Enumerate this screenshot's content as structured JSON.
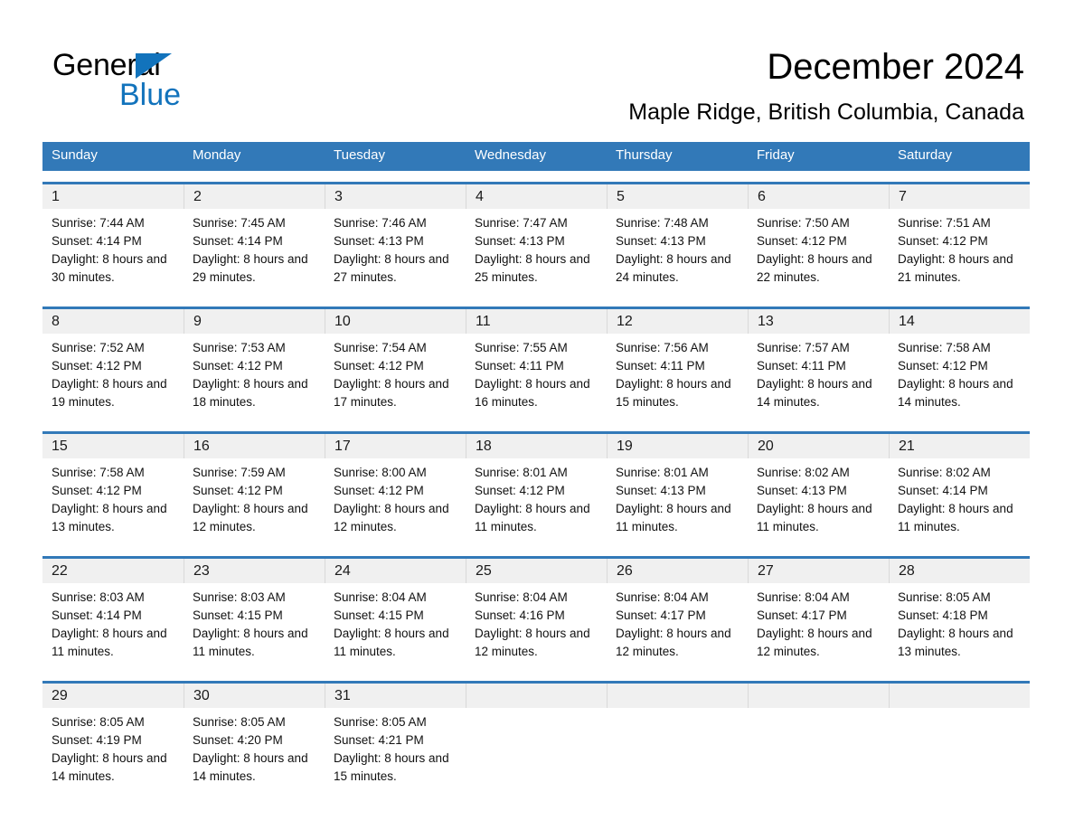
{
  "brand": {
    "name_part1": "General",
    "name_part2": "Blue",
    "accent_color": "#1273BC"
  },
  "header": {
    "title": "December 2024",
    "subtitle": "Maple Ridge, British Columbia, Canada"
  },
  "calendar": {
    "header_bg": "#3279B8",
    "header_text_color": "#FFFFFF",
    "daynum_bg": "#F0F0F0",
    "weekday_headers": [
      "Sunday",
      "Monday",
      "Tuesday",
      "Wednesday",
      "Thursday",
      "Friday",
      "Saturday"
    ],
    "weeks": [
      {
        "days": [
          {
            "num": "1",
            "sunrise": "Sunrise: 7:44 AM",
            "sunset": "Sunset: 4:14 PM",
            "daylight": "Daylight: 8 hours and 30 minutes."
          },
          {
            "num": "2",
            "sunrise": "Sunrise: 7:45 AM",
            "sunset": "Sunset: 4:14 PM",
            "daylight": "Daylight: 8 hours and 29 minutes."
          },
          {
            "num": "3",
            "sunrise": "Sunrise: 7:46 AM",
            "sunset": "Sunset: 4:13 PM",
            "daylight": "Daylight: 8 hours and 27 minutes."
          },
          {
            "num": "4",
            "sunrise": "Sunrise: 7:47 AM",
            "sunset": "Sunset: 4:13 PM",
            "daylight": "Daylight: 8 hours and 25 minutes."
          },
          {
            "num": "5",
            "sunrise": "Sunrise: 7:48 AM",
            "sunset": "Sunset: 4:13 PM",
            "daylight": "Daylight: 8 hours and 24 minutes."
          },
          {
            "num": "6",
            "sunrise": "Sunrise: 7:50 AM",
            "sunset": "Sunset: 4:12 PM",
            "daylight": "Daylight: 8 hours and 22 minutes."
          },
          {
            "num": "7",
            "sunrise": "Sunrise: 7:51 AM",
            "sunset": "Sunset: 4:12 PM",
            "daylight": "Daylight: 8 hours and 21 minutes."
          }
        ]
      },
      {
        "days": [
          {
            "num": "8",
            "sunrise": "Sunrise: 7:52 AM",
            "sunset": "Sunset: 4:12 PM",
            "daylight": "Daylight: 8 hours and 19 minutes."
          },
          {
            "num": "9",
            "sunrise": "Sunrise: 7:53 AM",
            "sunset": "Sunset: 4:12 PM",
            "daylight": "Daylight: 8 hours and 18 minutes."
          },
          {
            "num": "10",
            "sunrise": "Sunrise: 7:54 AM",
            "sunset": "Sunset: 4:12 PM",
            "daylight": "Daylight: 8 hours and 17 minutes."
          },
          {
            "num": "11",
            "sunrise": "Sunrise: 7:55 AM",
            "sunset": "Sunset: 4:11 PM",
            "daylight": "Daylight: 8 hours and 16 minutes."
          },
          {
            "num": "12",
            "sunrise": "Sunrise: 7:56 AM",
            "sunset": "Sunset: 4:11 PM",
            "daylight": "Daylight: 8 hours and 15 minutes."
          },
          {
            "num": "13",
            "sunrise": "Sunrise: 7:57 AM",
            "sunset": "Sunset: 4:11 PM",
            "daylight": "Daylight: 8 hours and 14 minutes."
          },
          {
            "num": "14",
            "sunrise": "Sunrise: 7:58 AM",
            "sunset": "Sunset: 4:12 PM",
            "daylight": "Daylight: 8 hours and 14 minutes."
          }
        ]
      },
      {
        "days": [
          {
            "num": "15",
            "sunrise": "Sunrise: 7:58 AM",
            "sunset": "Sunset: 4:12 PM",
            "daylight": "Daylight: 8 hours and 13 minutes."
          },
          {
            "num": "16",
            "sunrise": "Sunrise: 7:59 AM",
            "sunset": "Sunset: 4:12 PM",
            "daylight": "Daylight: 8 hours and 12 minutes."
          },
          {
            "num": "17",
            "sunrise": "Sunrise: 8:00 AM",
            "sunset": "Sunset: 4:12 PM",
            "daylight": "Daylight: 8 hours and 12 minutes."
          },
          {
            "num": "18",
            "sunrise": "Sunrise: 8:01 AM",
            "sunset": "Sunset: 4:12 PM",
            "daylight": "Daylight: 8 hours and 11 minutes."
          },
          {
            "num": "19",
            "sunrise": "Sunrise: 8:01 AM",
            "sunset": "Sunset: 4:13 PM",
            "daylight": "Daylight: 8 hours and 11 minutes."
          },
          {
            "num": "20",
            "sunrise": "Sunrise: 8:02 AM",
            "sunset": "Sunset: 4:13 PM",
            "daylight": "Daylight: 8 hours and 11 minutes."
          },
          {
            "num": "21",
            "sunrise": "Sunrise: 8:02 AM",
            "sunset": "Sunset: 4:14 PM",
            "daylight": "Daylight: 8 hours and 11 minutes."
          }
        ]
      },
      {
        "days": [
          {
            "num": "22",
            "sunrise": "Sunrise: 8:03 AM",
            "sunset": "Sunset: 4:14 PM",
            "daylight": "Daylight: 8 hours and 11 minutes."
          },
          {
            "num": "23",
            "sunrise": "Sunrise: 8:03 AM",
            "sunset": "Sunset: 4:15 PM",
            "daylight": "Daylight: 8 hours and 11 minutes."
          },
          {
            "num": "24",
            "sunrise": "Sunrise: 8:04 AM",
            "sunset": "Sunset: 4:15 PM",
            "daylight": "Daylight: 8 hours and 11 minutes."
          },
          {
            "num": "25",
            "sunrise": "Sunrise: 8:04 AM",
            "sunset": "Sunset: 4:16 PM",
            "daylight": "Daylight: 8 hours and 12 minutes."
          },
          {
            "num": "26",
            "sunrise": "Sunrise: 8:04 AM",
            "sunset": "Sunset: 4:17 PM",
            "daylight": "Daylight: 8 hours and 12 minutes."
          },
          {
            "num": "27",
            "sunrise": "Sunrise: 8:04 AM",
            "sunset": "Sunset: 4:17 PM",
            "daylight": "Daylight: 8 hours and 12 minutes."
          },
          {
            "num": "28",
            "sunrise": "Sunrise: 8:05 AM",
            "sunset": "Sunset: 4:18 PM",
            "daylight": "Daylight: 8 hours and 13 minutes."
          }
        ]
      },
      {
        "days": [
          {
            "num": "29",
            "sunrise": "Sunrise: 8:05 AM",
            "sunset": "Sunset: 4:19 PM",
            "daylight": "Daylight: 8 hours and 14 minutes."
          },
          {
            "num": "30",
            "sunrise": "Sunrise: 8:05 AM",
            "sunset": "Sunset: 4:20 PM",
            "daylight": "Daylight: 8 hours and 14 minutes."
          },
          {
            "num": "31",
            "sunrise": "Sunrise: 8:05 AM",
            "sunset": "Sunset: 4:21 PM",
            "daylight": "Daylight: 8 hours and 15 minutes."
          },
          {
            "num": "",
            "sunrise": "",
            "sunset": "",
            "daylight": ""
          },
          {
            "num": "",
            "sunrise": "",
            "sunset": "",
            "daylight": ""
          },
          {
            "num": "",
            "sunrise": "",
            "sunset": "",
            "daylight": ""
          },
          {
            "num": "",
            "sunrise": "",
            "sunset": "",
            "daylight": ""
          }
        ]
      }
    ]
  }
}
